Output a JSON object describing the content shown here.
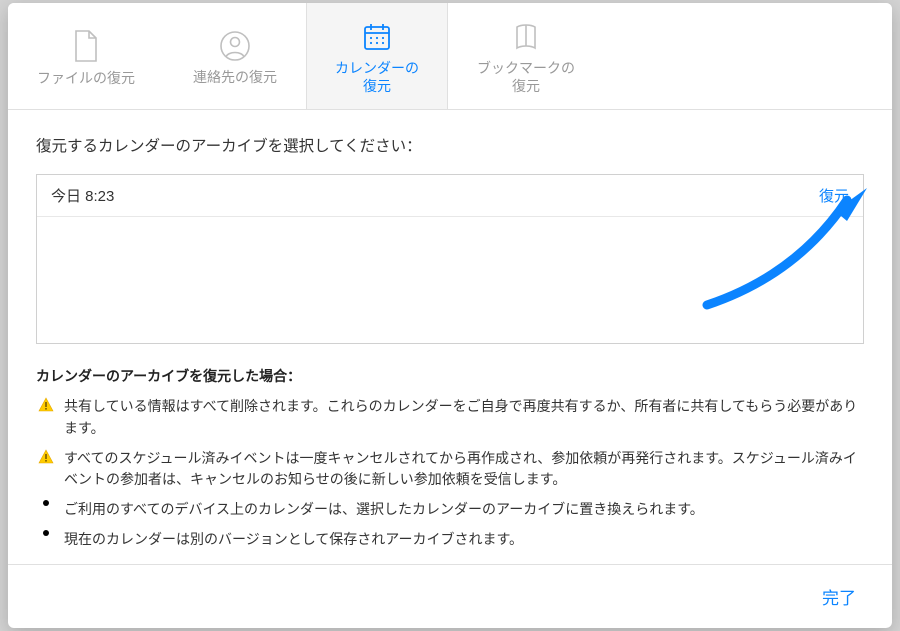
{
  "tabs": {
    "files": "ファイルの復元",
    "contacts": "連絡先の復元",
    "calendars": "カレンダーの\n復元",
    "bookmarks": "ブックマークの\n復元"
  },
  "instruction": "復元するカレンダーのアーカイブを選択してください：",
  "archive": {
    "time": "今日 8:23",
    "restore_label": "復元"
  },
  "info": {
    "heading": "カレンダーのアーカイブを復元した場合：",
    "items": [
      {
        "warn": true,
        "text": "共有している情報はすべて削除されます。これらのカレンダーをご自身で再度共有するか、所有者に共有してもらう必要があります。"
      },
      {
        "warn": true,
        "text": "すべてのスケジュール済みイベントは一度キャンセルされてから再作成され、参加依頼が再発行されます。スケジュール済みイベントの参加者は、キャンセルのお知らせの後に新しい参加依頼を受信します。"
      },
      {
        "warn": false,
        "text": "ご利用のすべてのデバイス上のカレンダーは、選択したカレンダーのアーカイブに置き換えられます。"
      },
      {
        "warn": false,
        "text": "現在のカレンダーは別のバージョンとして保存されアーカイブされます。"
      }
    ]
  },
  "footer": {
    "done_label": "完了"
  },
  "colors": {
    "accent": "#0b84ff"
  }
}
